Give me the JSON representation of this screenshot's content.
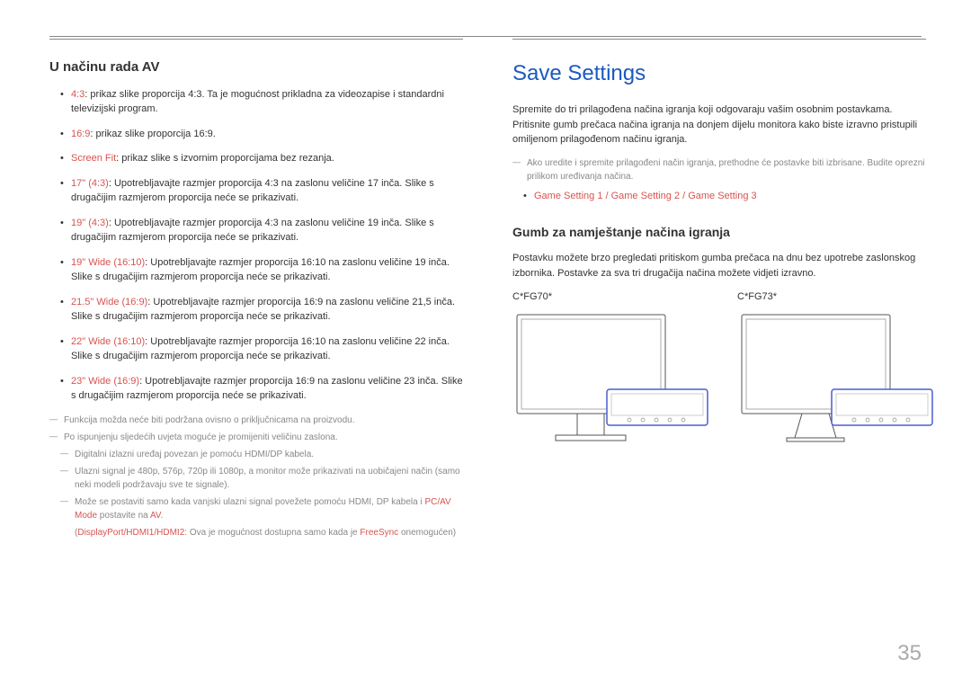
{
  "left": {
    "heading": "U načinu rada AV",
    "items": [
      {
        "label": "4:3",
        "text": ": prikaz slike proporcija 4:3. Ta je mogućnost prikladna za videozapise i standardni televizijski program."
      },
      {
        "label": "16:9",
        "text": ": prikaz slike proporcija 16:9."
      },
      {
        "label": "Screen Fit",
        "text": ": prikaz slike s izvornim proporcijama bez rezanja."
      },
      {
        "label": "17\" (4:3)",
        "text": ": Upotrebljavajte razmjer proporcija 4:3 na zaslonu veličine 17 inča. Slike s drugačijim razmjerom proporcija neće se prikazivati."
      },
      {
        "label": "19\" (4:3)",
        "text": ": Upotrebljavajte razmjer proporcija 4:3 na zaslonu veličine 19 inča. Slike s drugačijim razmjerom proporcija neće se prikazivati."
      },
      {
        "label": "19\" Wide (16:10)",
        "text": ": Upotrebljavajte razmjer proporcija 16:10 na zaslonu veličine 19 inča. Slike s drugačijim razmjerom proporcija neće se prikazivati."
      },
      {
        "label": "21.5\" Wide (16:9)",
        "text": ": Upotrebljavajte razmjer proporcija 16:9 na zaslonu veličine 21,5 inča. Slike s drugačijim razmjerom proporcija neće se prikazivati."
      },
      {
        "label": "22\" Wide (16:10)",
        "text": ": Upotrebljavajte razmjer proporcija 16:10 na zaslonu veličine 22 inča. Slike s drugačijim razmjerom proporcija neće se prikazivati."
      },
      {
        "label": "23\" Wide (16:9)",
        "text": ": Upotrebljavajte razmjer proporcija 16:9 na zaslonu veličine 23 inča. Slike s drugačijim razmjerom proporcija neće se prikazivati."
      }
    ],
    "notes": {
      "n1": "Funkcija možda neće biti podržana ovisno o priključnicama na proizvodu.",
      "n2": "Po ispunjenju sljedećih uvjeta moguće je promijeniti veličinu zaslona.",
      "n2a": "Digitalni izlazni uređaj povezan je pomoću HDMI/DP kabela.",
      "n2b": "Ulazni signal je 480p, 576p, 720p ili 1080p, a monitor može prikazivati na uobičajeni način (samo neki modeli podržavaju sve te signale).",
      "n2c_pre": "Može se postaviti samo kada vanjski ulazni signal povežete pomoću HDMI, DP kabela i ",
      "n2c_hl1": "PC/AV Mode",
      "n2c_mid": " postavite na ",
      "n2c_hl2": "AV",
      "n2c_post": ".",
      "n2c_sub_pre": "(",
      "n2c_sub_hl": "DisplayPort/HDMI1/HDMI2",
      "n2c_sub_mid": ": Ova je mogućnost dostupna samo kada je ",
      "n2c_sub_hl2": "FreeSync",
      "n2c_sub_post": " onemogućen)"
    }
  },
  "right": {
    "title": "Save Settings",
    "intro": "Spremite do tri prilagođena načina igranja koji odgovaraju vašim osobnim postavkama. Pritisnite gumb prečaca načina igranja na donjem dijelu monitora kako biste izravno pristupili omiljenom prilagođenom načinu igranja.",
    "note1": "Ako uredite i spremite prilagođeni način igranja, prethodne će postavke biti izbrisane. Budite oprezni prilikom uređivanja načina.",
    "settings_line": "Game Setting 1 / Game Setting 2 / Game Setting 3",
    "sub_heading": "Gumb za namještanje načina igranja",
    "sub_text": "Postavku možete brzo pregledati pritiskom gumba prečaca na dnu bez upotrebe zaslonskog izbornika. Postavke za sva tri drugačija načina možete vidjeti izravno.",
    "monitor_a": "C*FG70*",
    "monitor_b": "C*FG73*"
  },
  "page_number": "35"
}
